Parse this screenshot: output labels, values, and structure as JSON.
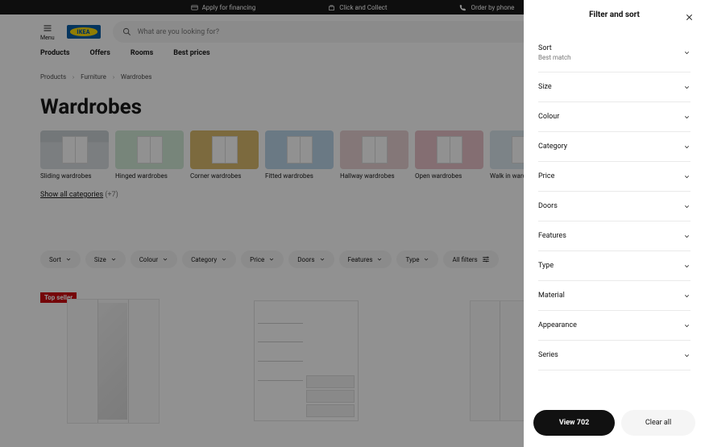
{
  "topbar": {
    "financing": "Apply for financing",
    "click_collect": "Click and Collect",
    "order_phone": "Order by phone"
  },
  "header": {
    "menu": "Menu",
    "logo": "IKEA",
    "search_placeholder": "What are you looking for?"
  },
  "nav": {
    "products": "Products",
    "offers": "Offers",
    "rooms": "Rooms",
    "best_prices": "Best prices"
  },
  "crumbs": {
    "products": "Products",
    "furniture": "Furniture",
    "wardrobes": "Wardrobes"
  },
  "title": "Wardrobes",
  "categories": [
    {
      "label": "Sliding wardrobes"
    },
    {
      "label": "Hinged wardrobes"
    },
    {
      "label": "Corner wardrobes"
    },
    {
      "label": "Fitted wardrobes"
    },
    {
      "label": "Hallway wardrobes"
    },
    {
      "label": "Open wardrobes"
    },
    {
      "label": "Walk in wardrobes"
    }
  ],
  "showall": {
    "text": "Show all categories",
    "count": "(+7)"
  },
  "pills": {
    "sort": "Sort",
    "size": "Size",
    "colour": "Colour",
    "category": "Category",
    "price": "Price",
    "doors": "Doors",
    "features": "Features",
    "type": "Type",
    "all": "All filters"
  },
  "badge": "Top seller",
  "panel": {
    "title": "Filter and sort",
    "sort": {
      "label": "Sort",
      "value": "Best match"
    },
    "filters": [
      {
        "label": "Size"
      },
      {
        "label": "Colour"
      },
      {
        "label": "Category"
      },
      {
        "label": "Price"
      },
      {
        "label": "Doors"
      },
      {
        "label": "Features"
      },
      {
        "label": "Type"
      },
      {
        "label": "Material"
      },
      {
        "label": "Appearance"
      },
      {
        "label": "Series"
      }
    ],
    "view_prefix": "View ",
    "view_count": "702",
    "clear": "Clear all"
  }
}
